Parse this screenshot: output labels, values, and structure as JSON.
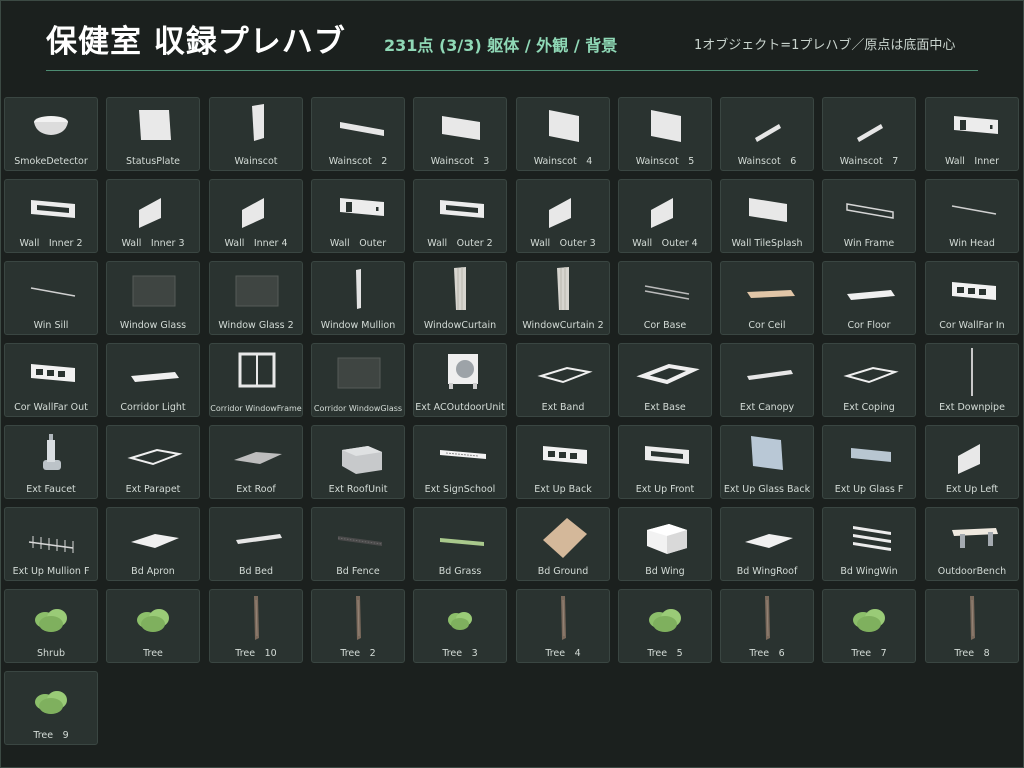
{
  "header": {
    "title": "保健室 収録プレハブ",
    "subtitle": "231点 (3/3) 躯体 / 外観 / 背景",
    "note": "1オブジェクト=1プレハブ／原点は底面中心"
  },
  "colors": {
    "accent": "#8fd8b6",
    "rule": "#4d8c72",
    "card": "#2a3330",
    "background": "#1b201e"
  },
  "items": [
    {
      "label": "SmokeDetector",
      "icon": "smoke-detector"
    },
    {
      "label": "StatusPlate",
      "icon": "plate"
    },
    {
      "label": "Wainscot",
      "icon": "panel-tall"
    },
    {
      "label": "Wainscot　2",
      "icon": "strip"
    },
    {
      "label": "Wainscot　3",
      "icon": "panel-wide"
    },
    {
      "label": "Wainscot　4",
      "icon": "panel"
    },
    {
      "label": "Wainscot　5",
      "icon": "panel"
    },
    {
      "label": "Wainscot　6",
      "icon": "diag-strip"
    },
    {
      "label": "Wainscot　7",
      "icon": "diag-strip"
    },
    {
      "label": "Wall　Inner",
      "icon": "wall-door"
    },
    {
      "label": "Wall　Inner 2",
      "icon": "wall-window"
    },
    {
      "label": "Wall　Inner 3",
      "icon": "panel-skew"
    },
    {
      "label": "Wall　Inner 4",
      "icon": "panel-skew"
    },
    {
      "label": "Wall　Outer",
      "icon": "wall-door"
    },
    {
      "label": "Wall　Outer 2",
      "icon": "wall-window"
    },
    {
      "label": "Wall　Outer 3",
      "icon": "panel-skew"
    },
    {
      "label": "Wall　Outer 4",
      "icon": "panel-skew"
    },
    {
      "label": "Wall TileSplash",
      "icon": "panel-wide"
    },
    {
      "label": "Win Frame",
      "icon": "frame-thin"
    },
    {
      "label": "Win Head",
      "icon": "line"
    },
    {
      "label": "Win Sill",
      "icon": "line"
    },
    {
      "label": "Window Glass",
      "icon": "glass"
    },
    {
      "label": "Window Glass 2",
      "icon": "glass"
    },
    {
      "label": "Window Mullion",
      "icon": "mullion"
    },
    {
      "label": "WindowCurtain",
      "icon": "curtain"
    },
    {
      "label": "WindowCurtain 2",
      "icon": "curtain"
    },
    {
      "label": "Cor Base",
      "icon": "double-line"
    },
    {
      "label": "Cor Ceil",
      "icon": "flat-tan"
    },
    {
      "label": "Cor Floor",
      "icon": "flat-white"
    },
    {
      "label": "Cor WallFar In",
      "icon": "window-row"
    },
    {
      "label": "Cor WallFar Out",
      "icon": "window-row"
    },
    {
      "label": "Corridor Light",
      "icon": "flat-white"
    },
    {
      "label": "Corridor WindowFrame",
      "icon": "window-frame"
    },
    {
      "label": "Corridor WindowGlass",
      "icon": "glass"
    },
    {
      "label": "Ext ACOutdoorUnit",
      "icon": "ac-unit"
    },
    {
      "label": "Ext Band",
      "icon": "ring-flat"
    },
    {
      "label": "Ext Base",
      "icon": "ring-thick"
    },
    {
      "label": "Ext Canopy",
      "icon": "strip-flat"
    },
    {
      "label": "Ext Coping",
      "icon": "ring-flat"
    },
    {
      "label": "Ext Downpipe",
      "icon": "pipe"
    },
    {
      "label": "Ext Faucet",
      "icon": "faucet"
    },
    {
      "label": "Ext Parapet",
      "icon": "ring-flat"
    },
    {
      "label": "Ext Roof",
      "icon": "roof"
    },
    {
      "label": "Ext RoofUnit",
      "icon": "roof-unit"
    },
    {
      "label": "Ext SignSchool",
      "icon": "sign"
    },
    {
      "label": "Ext Up Back",
      "icon": "window-row"
    },
    {
      "label": "Ext Up Front",
      "icon": "wall-window"
    },
    {
      "label": "Ext Up Glass Back",
      "icon": "glass-blue"
    },
    {
      "label": "Ext Up Glass F",
      "icon": "strip-blue"
    },
    {
      "label": "Ext Up Left",
      "icon": "panel-skew"
    },
    {
      "label": "Ext Up Mullion F",
      "icon": "fence"
    },
    {
      "label": "Bd Apron",
      "icon": "roof-white"
    },
    {
      "label": "Bd Bed",
      "icon": "strip-flat"
    },
    {
      "label": "Bd Fence",
      "icon": "fence-dark"
    },
    {
      "label": "Bd Grass",
      "icon": "grass"
    },
    {
      "label": "Bd Ground",
      "icon": "ground"
    },
    {
      "label": "Bd Wing",
      "icon": "wing"
    },
    {
      "label": "Bd WingRoof",
      "icon": "roof-white"
    },
    {
      "label": "Bd WingWin",
      "icon": "stripes"
    },
    {
      "label": "OutdoorBench",
      "icon": "bench"
    },
    {
      "label": "Shrub",
      "icon": "bush"
    },
    {
      "label": "Tree",
      "icon": "bush"
    },
    {
      "label": "Tree　10",
      "icon": "trunk"
    },
    {
      "label": "Tree　2",
      "icon": "trunk"
    },
    {
      "label": "Tree　3",
      "icon": "bush-small"
    },
    {
      "label": "Tree　4",
      "icon": "trunk"
    },
    {
      "label": "Tree　5",
      "icon": "bush"
    },
    {
      "label": "Tree　6",
      "icon": "trunk"
    },
    {
      "label": "Tree　7",
      "icon": "bush"
    },
    {
      "label": "Tree　8",
      "icon": "trunk"
    },
    {
      "label": "Tree　9",
      "icon": "bush"
    }
  ]
}
